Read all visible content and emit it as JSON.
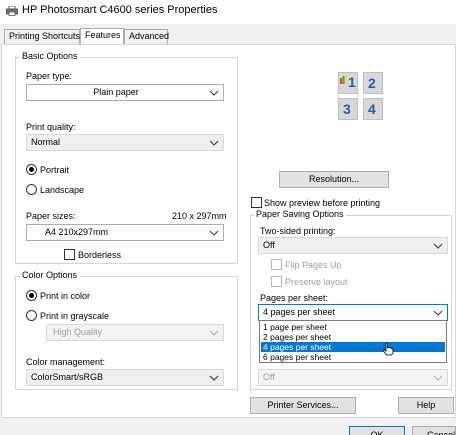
{
  "window": {
    "title": "HP Photosmart C4600 series Properties"
  },
  "tabs": [
    {
      "label": "Printing Shortcuts"
    },
    {
      "label": "Features"
    },
    {
      "label": "Advanced"
    }
  ],
  "basic_options": {
    "title": "Basic Options",
    "paper_type_label": "Paper type:",
    "paper_type_value": "Plain paper",
    "print_quality_label": "Print quality:",
    "print_quality_value": "Normal",
    "portrait_label": "Portrait",
    "landscape_label": "Landscape",
    "paper_sizes_label": "Paper sizes:",
    "paper_sizes_dims": "210 x 297mm",
    "paper_size_value": "A4 210x297mm",
    "borderless_label": "Borderless"
  },
  "color_options": {
    "title": "Color Options",
    "print_in_color_label": "Print in color",
    "print_in_grayscale_label": "Print in grayscale",
    "grayscale_quality_value": "High Quality",
    "color_management_label": "Color management:",
    "color_management_value": "ColorSmart/sRGB"
  },
  "preview": {
    "page_numbers": [
      "1",
      "2",
      "3",
      "4"
    ]
  },
  "resolution_button": "Resolution...",
  "show_preview_label": "Show preview before printing",
  "paper_saving": {
    "title": "Paper Saving Options",
    "two_sided_label": "Two-sided printing:",
    "two_sided_value": "Off",
    "flip_pages_label": "Flip Pages Up",
    "preserve_layout_label": "Preserve layout",
    "pages_per_sheet_label": "Pages per sheet:",
    "pages_per_sheet_value": "4 pages per sheet",
    "pages_per_sheet_options": [
      "1 page per sheet",
      "2 pages per sheet",
      "4 pages per sheet",
      "6 pages per sheet"
    ],
    "page_order_value": "Off"
  },
  "printer_services_button": "Printer Services...",
  "help_button": "Help",
  "ok_button": "OK",
  "cancel_button": "Cancel"
}
